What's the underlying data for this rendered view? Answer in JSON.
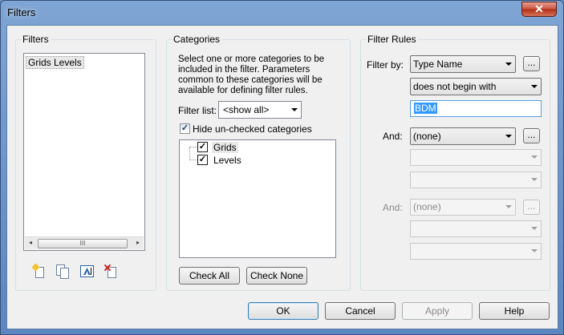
{
  "window": {
    "title": "Filters",
    "close_glyph": "✕"
  },
  "filters_panel": {
    "label": "Filters",
    "items": [
      "Grids Levels"
    ],
    "scroll_left": "◂",
    "scroll_right": "▸",
    "scroll_thumb": "III",
    "tools": [
      "new-filter-icon",
      "duplicate-filter-icon",
      "rename-filter-icon",
      "delete-filter-icon"
    ]
  },
  "categories_panel": {
    "label": "Categories",
    "description": "Select one or more categories to be included in the filter.  Parameters common to these categories will be available for defining filter rules.",
    "filter_list_label": "Filter list:",
    "filter_list_value": "<show all>",
    "hide_unchecked_label": "Hide un-checked categories",
    "hide_unchecked_checked": true,
    "tree": [
      {
        "label": "Grids",
        "checked": true
      },
      {
        "label": "Levels",
        "checked": true
      }
    ],
    "check_all": "Check All",
    "check_none": "Check None"
  },
  "rules_panel": {
    "label": "Filter Rules",
    "filter_by_label": "Filter by:",
    "rule1": {
      "parameter": "Type Name",
      "operator": "does not begin with",
      "value": "BDM"
    },
    "and_label_1": "And:",
    "rule2": {
      "parameter": "(none)"
    },
    "and_label_2": "And:",
    "rule3": {
      "parameter": "(none)"
    },
    "ellipsis": "..."
  },
  "footer": {
    "ok": "OK",
    "cancel": "Cancel",
    "apply": "Apply",
    "help": "Help"
  },
  "colors": {
    "selection": "#3399ff",
    "title_bar": "#6a93c8",
    "close_button": "#c7503b"
  }
}
